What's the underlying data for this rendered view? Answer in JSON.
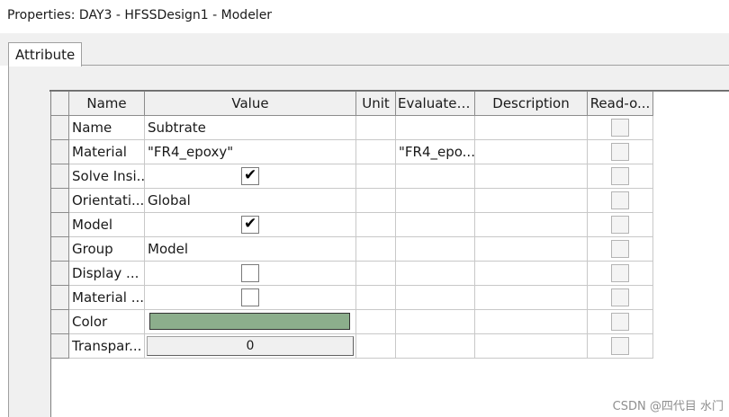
{
  "window": {
    "title": "Properties: DAY3 - HFSSDesign1 - Modeler"
  },
  "tabs": [
    {
      "label": "Attribute",
      "selected": true
    }
  ],
  "grid": {
    "columns": [
      "Name",
      "Value",
      "Unit",
      "Evaluated...",
      "Description",
      "Read-o..."
    ],
    "rows": [
      {
        "name": "Name",
        "value": "Subtrate",
        "evaluated": ""
      },
      {
        "name": "Material",
        "value": "\"FR4_epoxy\"",
        "evaluated": "\"FR4_epo..."
      },
      {
        "name": "Solve Insi...",
        "checkbox": true
      },
      {
        "name": "Orientati...",
        "value": "Global",
        "evaluated": ""
      },
      {
        "name": "Model",
        "checkbox": true
      },
      {
        "name": "Group",
        "value": "Model",
        "evaluated": ""
      },
      {
        "name": "Display ...",
        "checkbox": false
      },
      {
        "name": "Material ...",
        "checkbox": false
      },
      {
        "name": "Color",
        "color": "#8cae8c"
      },
      {
        "name": "Transpar...",
        "value": "0"
      }
    ]
  },
  "watermark": "CSDN @四代目  水门"
}
